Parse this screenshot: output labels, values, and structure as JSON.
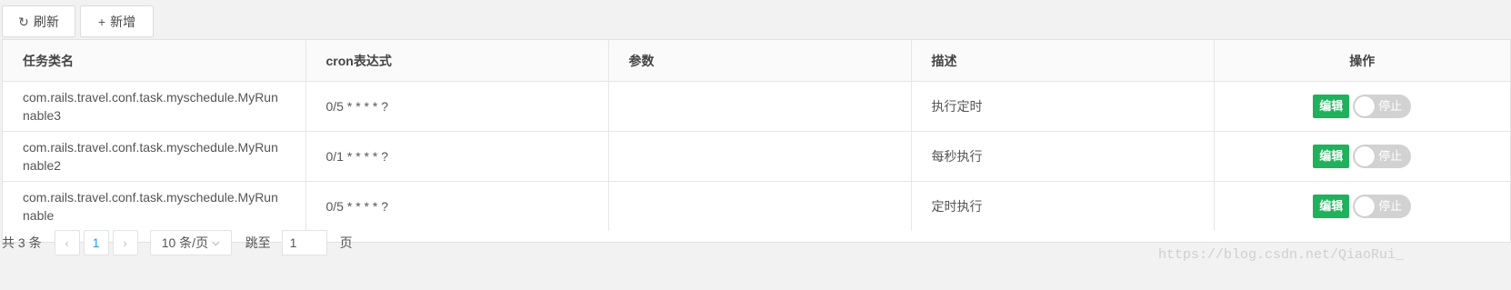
{
  "toolbar": {
    "refresh_label": "刷新",
    "add_label": "新增",
    "refresh_icon": "refresh-icon",
    "add_icon": "plus-icon"
  },
  "table": {
    "headers": [
      "任务类名",
      "cron表达式",
      "参数",
      "描述",
      "操作"
    ],
    "rows": [
      {
        "class_name": "com.rails.travel.conf.task.myschedule.MyRunnable3",
        "cron": "0/5 * * * * ?",
        "params": "",
        "desc": "执行定时",
        "edit_label": "编辑",
        "switch_label": "停止"
      },
      {
        "class_name": "com.rails.travel.conf.task.myschedule.MyRunnable2",
        "cron": "0/1 * * * * ?",
        "params": "",
        "desc": "每秒执行",
        "edit_label": "编辑",
        "switch_label": "停止"
      },
      {
        "class_name": "com.rails.travel.conf.task.myschedule.MyRunnable",
        "cron": "0/5 * * * * ?",
        "params": "",
        "desc": "定时执行",
        "edit_label": "编辑",
        "switch_label": "停止"
      }
    ]
  },
  "pagination": {
    "total_text": "共 3 条",
    "current_page": "1",
    "page_size": "10 条/页",
    "jump_label": "跳至",
    "jump_value": "1",
    "page_suffix": "页"
  },
  "watermark": "https://blog.csdn.net/QiaoRui_",
  "colors": {
    "edit_button": "#1fb15b",
    "switch_off": "#d2d2d2",
    "active_page": "#1e9fff"
  }
}
